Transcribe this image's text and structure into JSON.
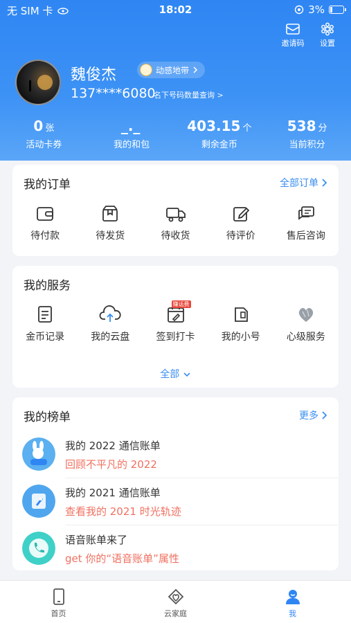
{
  "status_bar": {
    "carrier": "无 SIM 卡",
    "time": "18:02",
    "battery": "3%"
  },
  "top_actions": [
    {
      "label": "邀请码",
      "icon": "invite-card-icon"
    },
    {
      "label": "设置",
      "icon": "gear-icon"
    }
  ],
  "user": {
    "name": "魏俊杰",
    "level": "动感地带",
    "phone": "137****6080",
    "phone_link": "名下号码数量查询 >"
  },
  "stats": [
    {
      "value": "0",
      "unit": "张",
      "label": "活动卡券"
    },
    {
      "value": "_._",
      "unit": "",
      "label": "我的和包"
    },
    {
      "value": "403.15",
      "unit": "个",
      "label": "剩余金币"
    },
    {
      "value": "538",
      "unit": "分",
      "label": "当前积分"
    }
  ],
  "orders": {
    "title": "我的订单",
    "more": "全部订单",
    "items": [
      {
        "label": "待付款",
        "icon": "wallet-icon"
      },
      {
        "label": "待发货",
        "icon": "package-icon"
      },
      {
        "label": "待收货",
        "icon": "truck-icon"
      },
      {
        "label": "待评价",
        "icon": "edit-icon"
      },
      {
        "label": "售后咨询",
        "icon": "chat-icon"
      }
    ]
  },
  "services": {
    "title": "我的服务",
    "expand": "全部",
    "items": [
      {
        "label": "金币记录",
        "icon": "document-icon",
        "tag": ""
      },
      {
        "label": "我的云盘",
        "icon": "cloud-upload-icon",
        "tag": ""
      },
      {
        "label": "签到打卡",
        "icon": "calendar-icon",
        "tag": "赚话费"
      },
      {
        "label": "我的小号",
        "icon": "sim-card-icon",
        "tag": ""
      },
      {
        "label": "心级服务",
        "icon": "heart-level-icon",
        "tag": ""
      }
    ]
  },
  "rankings": {
    "title": "我的榜单",
    "more": "更多",
    "items": [
      {
        "title": "我的 2022 通信账单",
        "subtitle": "回顾不平凡的 2022",
        "icon": "rabbit-2022-icon"
      },
      {
        "title": "我的 2021 通信账单",
        "subtitle": "查看我的 2021 时光轨迹",
        "icon": "rocket-icon"
      },
      {
        "title": "语音账单来了",
        "subtitle": "get 你的“语音账单”属性",
        "icon": "phone-call-icon"
      }
    ]
  },
  "tabbar": [
    {
      "label": "首页",
      "icon": "phone-device-icon"
    },
    {
      "label": "云家庭",
      "icon": "cloud-family-icon"
    },
    {
      "label": "我",
      "icon": "person-icon"
    }
  ],
  "colors": {
    "primary": "#2f86f3",
    "accent_red": "#f07060"
  }
}
